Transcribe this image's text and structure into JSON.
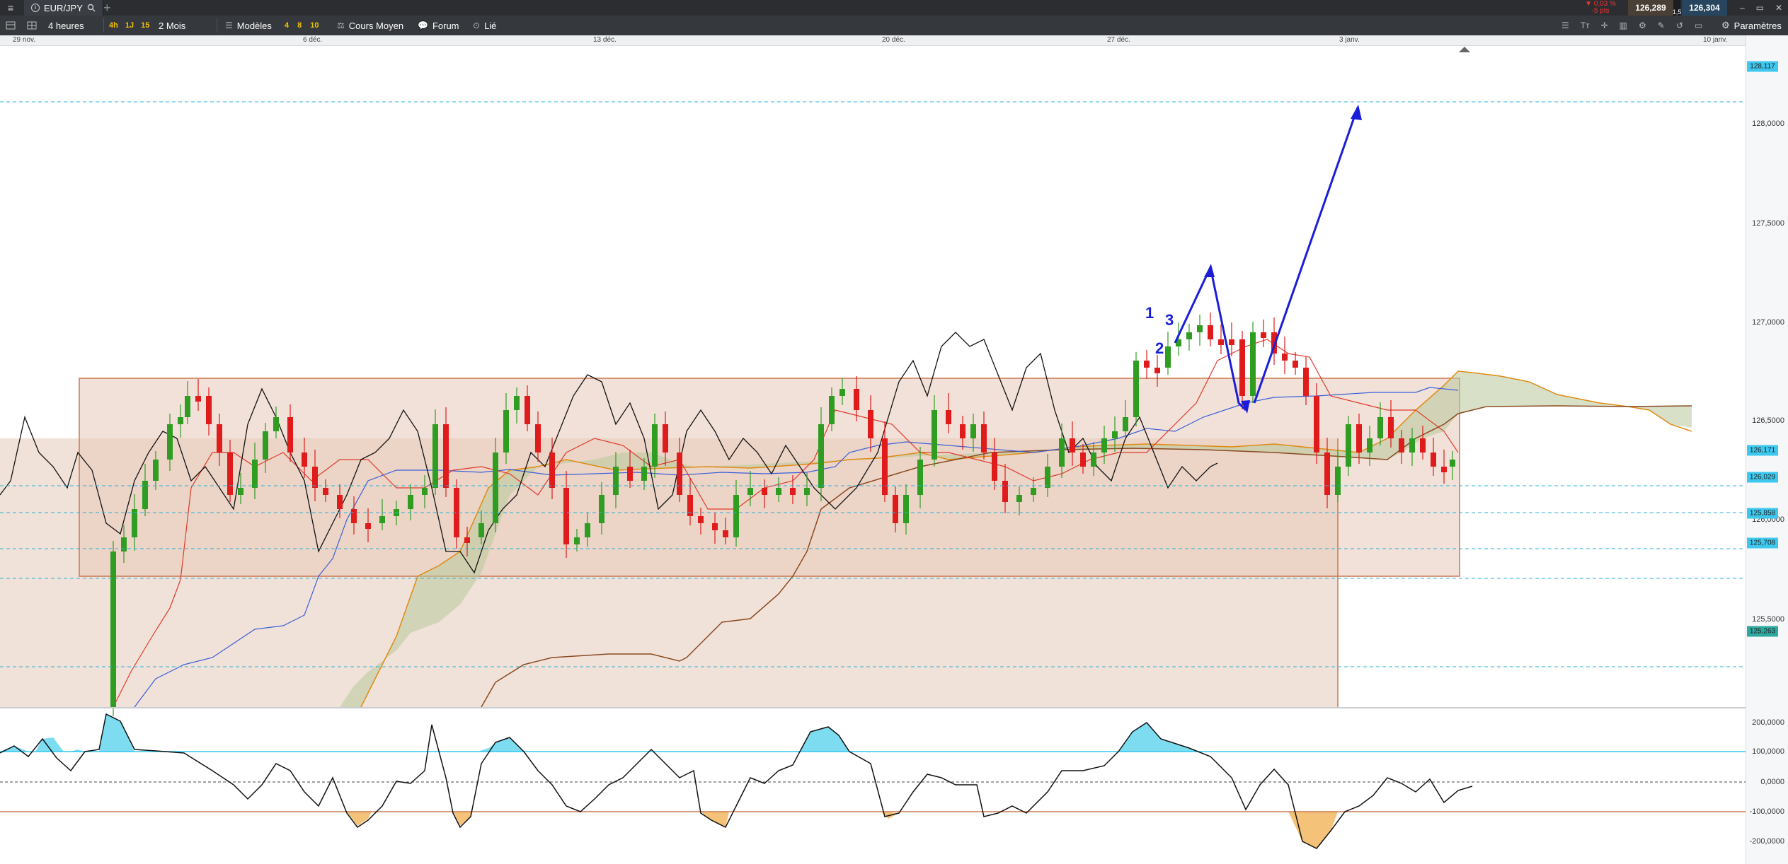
{
  "tabbar": {
    "menu_glyph": "≡",
    "tab_label": "EUR/JPY",
    "plus_glyph": "+",
    "price_change": "▼ 0,03 %",
    "points": "-5 pts",
    "bid": "126,289",
    "ask": "126,304",
    "spread": "1,5",
    "min_glyph": "–",
    "max_glyph": "▭",
    "close_glyph": "✕"
  },
  "toolbar": {
    "timeframe": "4 heures",
    "quick_periods": [
      "4h",
      "1J",
      "15"
    ],
    "range": "2 Mois",
    "templates": "Modèles",
    "template_numbers": [
      "4",
      "8",
      "10"
    ],
    "average_price": "Cours Moyen",
    "forum": "Forum",
    "linked": "Lié",
    "settings": "Paramètres"
  },
  "date_labels": [
    "29 nov.",
    "6 déc.",
    "13 déc.",
    "20 déc.",
    "27 déc.",
    "3 janv.",
    "10 janv."
  ],
  "price_labels": [
    "128,0000",
    "127,5000",
    "127,0000",
    "126,5000",
    "126,0000",
    "125,5000"
  ],
  "price_tags": [
    "128,117",
    "126,171",
    "126,029",
    "125,858",
    "125,708",
    "125,263"
  ],
  "oscillator_labels": [
    "200,0000",
    "100,0000",
    "0,0000",
    "-100,0000",
    "-200,0000"
  ],
  "annotations": [
    "1",
    "2",
    "3"
  ],
  "colors": {
    "bull": "#2e9d22",
    "bear": "#e01b1b",
    "kijun": "#3a5fd9",
    "tenkan": "#e03a2a",
    "chikou": "#111111",
    "cloud_line": "#e08a10",
    "projection": "#1a1ed8",
    "cci_high": "#7ddcf0",
    "cci_low": "#f5c27a"
  }
}
